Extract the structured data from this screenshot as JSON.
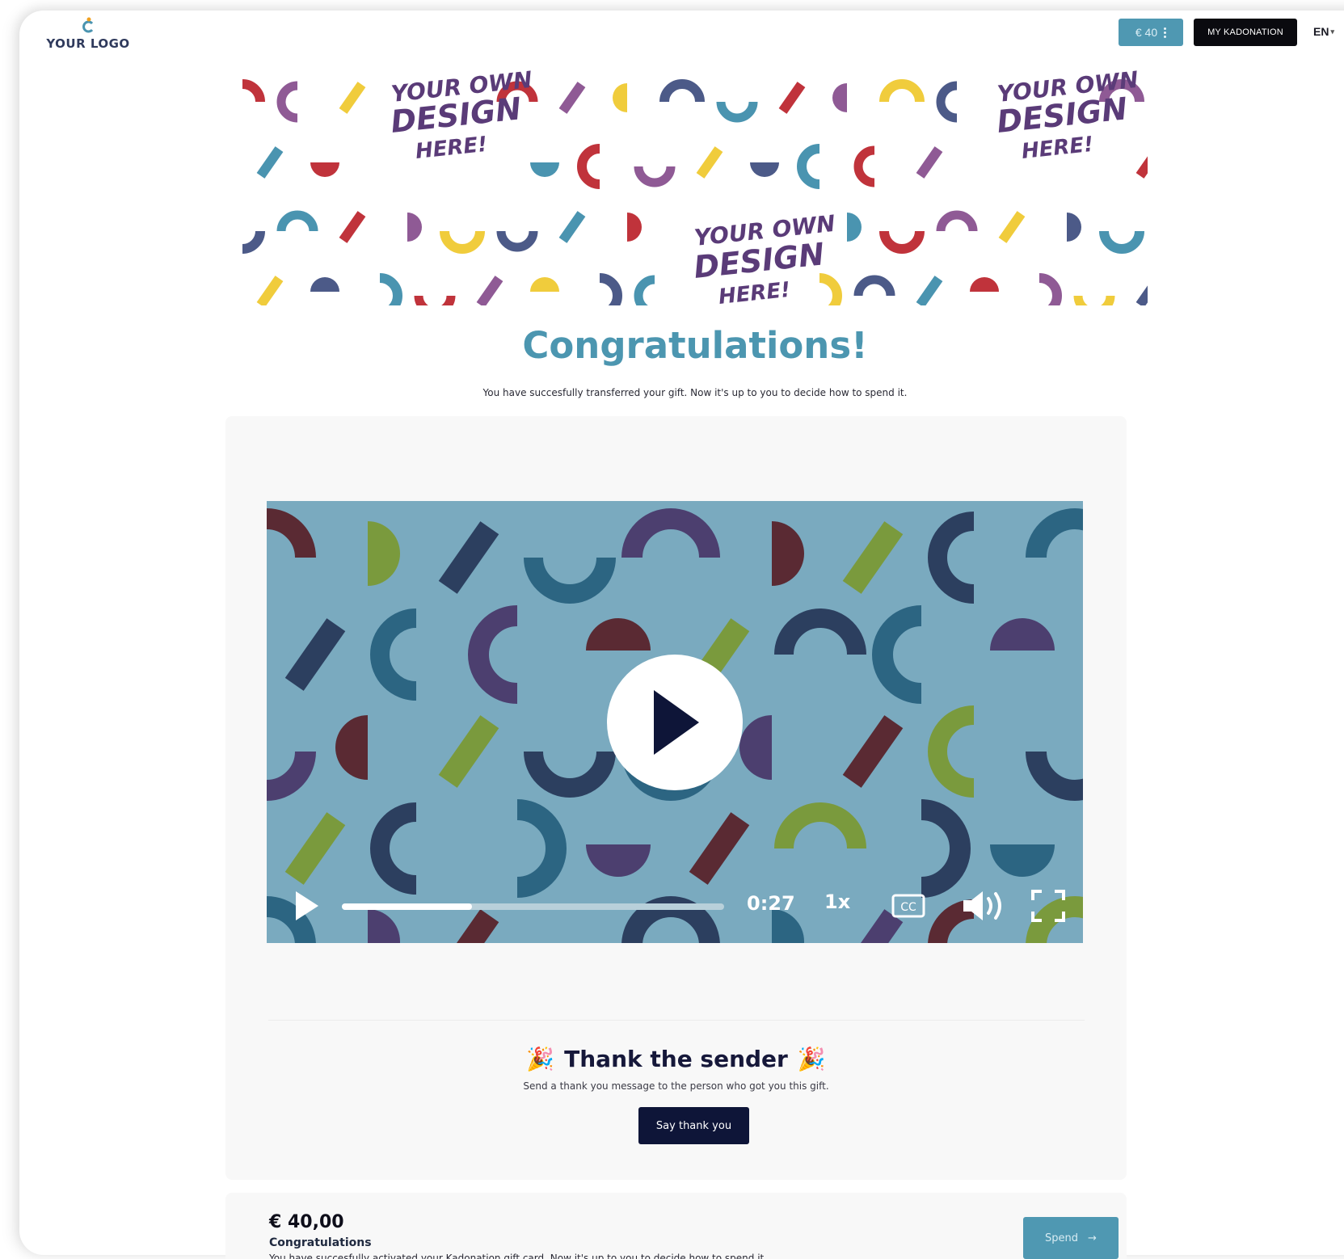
{
  "header": {
    "logo_text": "YOUR LOGO",
    "balance_label": "€ 40",
    "account_button": "MY KADONATION",
    "language": "EN"
  },
  "banner": {
    "texts": [
      "YOUR OWN",
      "DESIGN",
      "HERE!"
    ]
  },
  "main": {
    "title": "Congratulations!",
    "subtitle": "You have succesfully transferred your gift. Now it's up to you to decide how to spend it."
  },
  "video": {
    "time": "0:27",
    "speed": "1x",
    "cc_label": "CC",
    "progress": 0.34
  },
  "thank": {
    "title": "Thank the sender",
    "emoji_left": "🎉",
    "emoji_right": "🎉",
    "subtitle": "Send a thank you message to the person who got you this gift.",
    "button": "Say thank you"
  },
  "gift_card": {
    "amount": "€ 40,00",
    "title": "Congratulations",
    "description": "You have succesfully activated your Kadonation gift card. Now it's up to you to decide how to spend it.",
    "spend_button": "Spend"
  },
  "colors": {
    "accent": "#4f98b2",
    "dark": "#0e1538",
    "banner_red": "#c0333b",
    "banner_yellow": "#f0cc3c",
    "banner_teal": "#4a94b0",
    "banner_purple": "#8f5a95",
    "video_bg": "#7aaabf"
  }
}
